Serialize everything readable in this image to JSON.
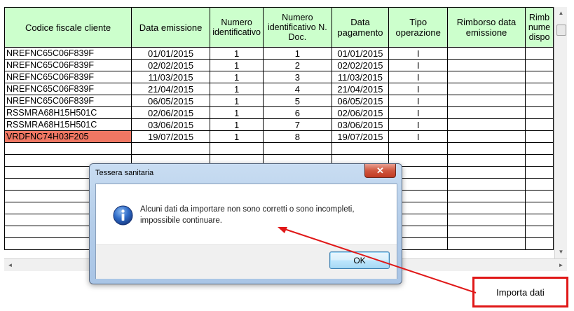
{
  "table": {
    "headers": {
      "codice": "Codice fiscale cliente",
      "data_emissione": "Data emissione",
      "numero_id": "Numero identificativo",
      "numero_id_doc": "Numero identificativo N. Doc.",
      "data_pagamento": "Data pagamento",
      "tipo_operazione": "Tipo operazione",
      "rimborso": "Rimborso data emissione",
      "rimb_disp": "Rimb nume dispo"
    },
    "rows": [
      {
        "codice": "NREFNC65C06F839F",
        "data_emissione": "01/01/2015",
        "numero_id": "1",
        "numero_doc": "1",
        "data_pagamento": "01/01/2015",
        "tipo": "I"
      },
      {
        "codice": "NREFNC65C06F839F",
        "data_emissione": "02/02/2015",
        "numero_id": "1",
        "numero_doc": "2",
        "data_pagamento": "02/02/2015",
        "tipo": "I"
      },
      {
        "codice": "NREFNC65C06F839F",
        "data_emissione": "11/03/2015",
        "numero_id": "1",
        "numero_doc": "3",
        "data_pagamento": "11/03/2015",
        "tipo": "I"
      },
      {
        "codice": "NREFNC65C06F839F",
        "data_emissione": "21/04/2015",
        "numero_id": "1",
        "numero_doc": "4",
        "data_pagamento": "21/04/2015",
        "tipo": "I"
      },
      {
        "codice": "NREFNC65C06F839F",
        "data_emissione": "06/05/2015",
        "numero_id": "1",
        "numero_doc": "5",
        "data_pagamento": "06/05/2015",
        "tipo": "I"
      },
      {
        "codice": "RSSMRA68H15H501C",
        "data_emissione": "02/06/2015",
        "numero_id": "1",
        "numero_doc": "6",
        "data_pagamento": "02/06/2015",
        "tipo": "I"
      },
      {
        "codice": "RSSMRA68H15H501C",
        "data_emissione": "03/06/2015",
        "numero_id": "1",
        "numero_doc": "7",
        "data_pagamento": "03/06/2015",
        "tipo": "I"
      },
      {
        "codice": "VRDFNC74H03F205",
        "data_emissione": "19/07/2015",
        "numero_id": "1",
        "numero_doc": "8",
        "data_pagamento": "19/07/2015",
        "tipo": "I",
        "invalid": true
      }
    ],
    "empty_rows": 9
  },
  "dialog": {
    "title": "Tessera sanitaria",
    "close_glyph": "✕",
    "message_line1": "Alcuni dati da importare non sono corretti o sono incompleti,",
    "message_line2": "impossibile continuare.",
    "ok_label": "OK",
    "icon": "info-icon"
  },
  "import_button": {
    "label": "Importa dati"
  },
  "colors": {
    "header_bg": "#ccffcc",
    "invalid_cell": "#ef7763",
    "annotation": "#e01818"
  },
  "scroll": {
    "up": "▲",
    "down": "▼",
    "left": "◄",
    "right": "►"
  }
}
